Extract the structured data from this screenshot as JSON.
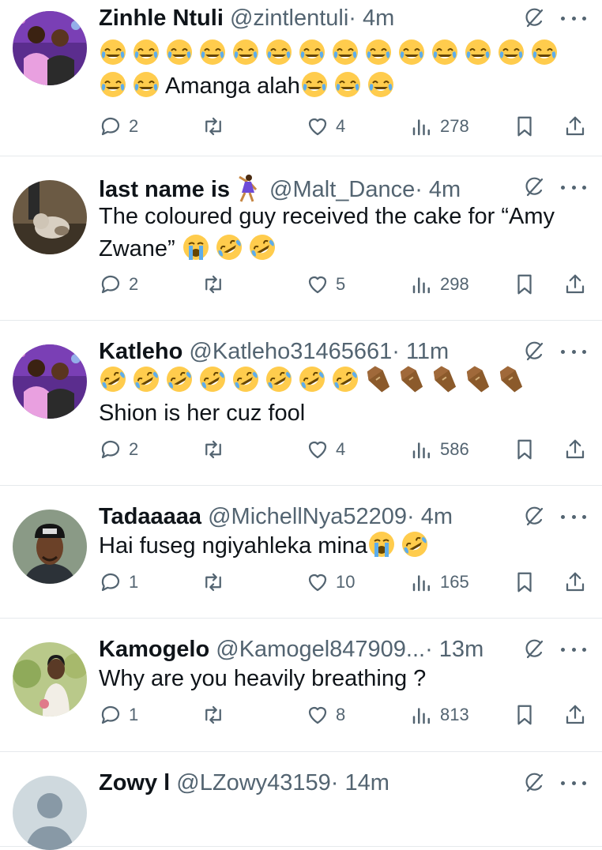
{
  "tweets": [
    {
      "name": "Zinhle Ntuli",
      "handle": "@zintlentuli",
      "time": "· 4m",
      "avatar": "couple-photo",
      "text_html": "😂 😂 😂 😂 😂 😂 😂 😂 😂 😂 😂 😂 😂 😂 😂 😂 Amanga alah😂 😂 😂",
      "text": "😂😂😂😂😂😂😂😂😂😂😂😂😂😂😂😂Amanga alah😂😂😂",
      "replies": "2",
      "retweets": "",
      "likes": "4",
      "views": "278"
    },
    {
      "name": "last name is",
      "handle": "@Malt_Dance",
      "time": "· 4m",
      "avatar": "dog-photo",
      "text": "The coloured guy received the cake for “Amy Zwane” 😭🤣🤣",
      "replies": "2",
      "retweets": "",
      "likes": "5",
      "views": "298"
    },
    {
      "name": "Katleho",
      "handle": "@Katleho31465661",
      "time": "· 11m",
      "avatar": "couple-photo",
      "text": "🤣🤣🤣🤣🤣🤣🤣🤣⚰️⚰️⚰️⚰️⚰️Shion is her cuz fool",
      "replies": "2",
      "retweets": "",
      "likes": "4",
      "views": "586"
    },
    {
      "name": "Tadaaaaa",
      "handle": "@MichellNya52209",
      "time": "· 4m",
      "avatar": "man-beanie-photo",
      "text": "Hai fuseg ngiyahleka mina😭🤣",
      "replies": "1",
      "retweets": "",
      "likes": "10",
      "views": "165"
    },
    {
      "name": "Kamogelo",
      "handle": "@Kamogel847909...",
      "time": "· 13m",
      "avatar": "woman-photo",
      "text": "Why are you heavily  breathing ?",
      "replies": "1",
      "retweets": "",
      "likes": "8",
      "views": "813"
    },
    {
      "name": "Zowy l",
      "handle": "@LZowy43159",
      "time": "· 14m",
      "avatar": "default-avatar",
      "text": "",
      "replies": "",
      "retweets": "",
      "likes": "",
      "views": ""
    }
  ],
  "icons": {
    "reply": "reply-icon",
    "retweet": "retweet-icon",
    "like": "heart-icon",
    "views": "views-icon",
    "bookmark": "bookmark-icon",
    "share": "share-icon",
    "grok": "grok-icon",
    "more": "more-icon"
  },
  "colors": {
    "text": "#0f1419",
    "secondary": "#536471",
    "divider": "#e6e9ec"
  }
}
